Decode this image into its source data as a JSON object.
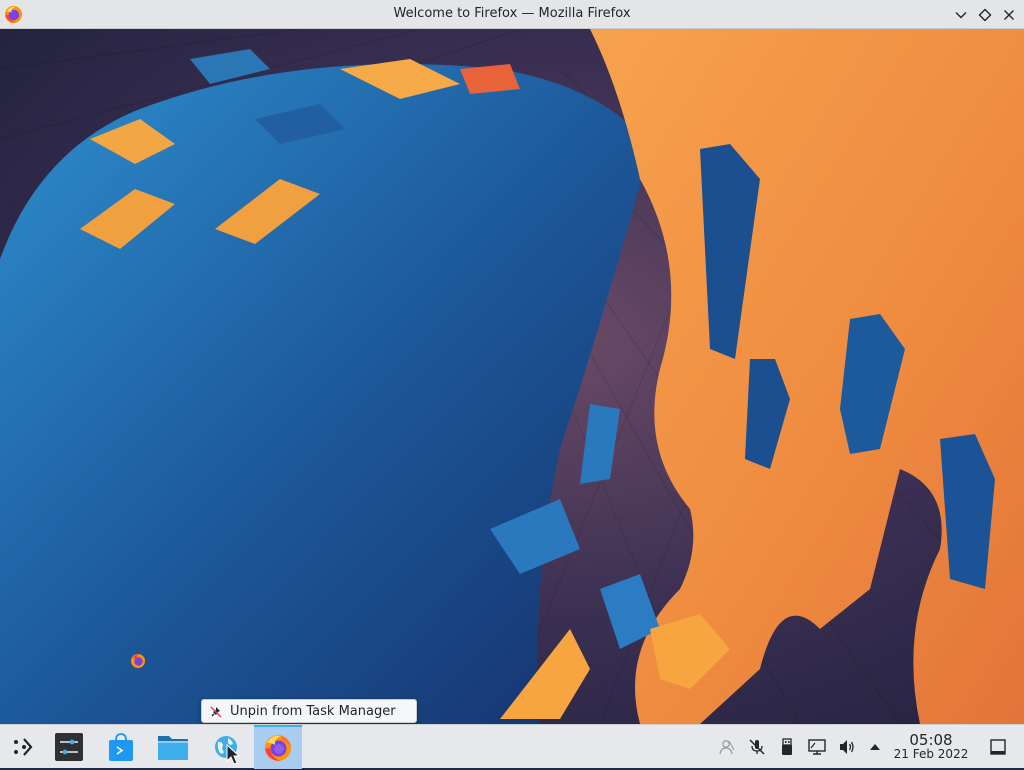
{
  "window": {
    "title": "Welcome to Firefox — Mozilla Firefox",
    "app_icon": "firefox-icon",
    "controls": [
      "chevron-down-icon",
      "diamond-icon",
      "close-icon"
    ]
  },
  "context_menu": {
    "item_icon": "unpin-icon",
    "item_label": "Unpin from Task Manager"
  },
  "taskbar": {
    "launcher_icon": "application-launcher-icon",
    "tasks": [
      {
        "name": "system-settings",
        "icon": "settings-sliders-icon"
      },
      {
        "name": "discover",
        "icon": "store-bag-icon"
      },
      {
        "name": "dolphin",
        "icon": "folder-icon"
      },
      {
        "name": "web-browser",
        "icon": "globe-icon"
      },
      {
        "name": "firefox",
        "icon": "firefox-icon",
        "active": true
      }
    ],
    "tray": [
      "user-icon",
      "microphone-muted-icon",
      "usb-drive-icon",
      "network-wired-icon",
      "volume-icon",
      "expand-tray-arrow-icon"
    ],
    "clock": {
      "time": "05:08",
      "date": "21 Feb 2022"
    },
    "show_desktop_icon": "show-desktop-icon"
  },
  "colors": {
    "accent": "#3daee9",
    "active_task": "#a9cdf0",
    "panel": "#e7e8eb",
    "wallpaper_blue": "#1b5fa0",
    "wallpaper_orange": "#f08a3c"
  }
}
